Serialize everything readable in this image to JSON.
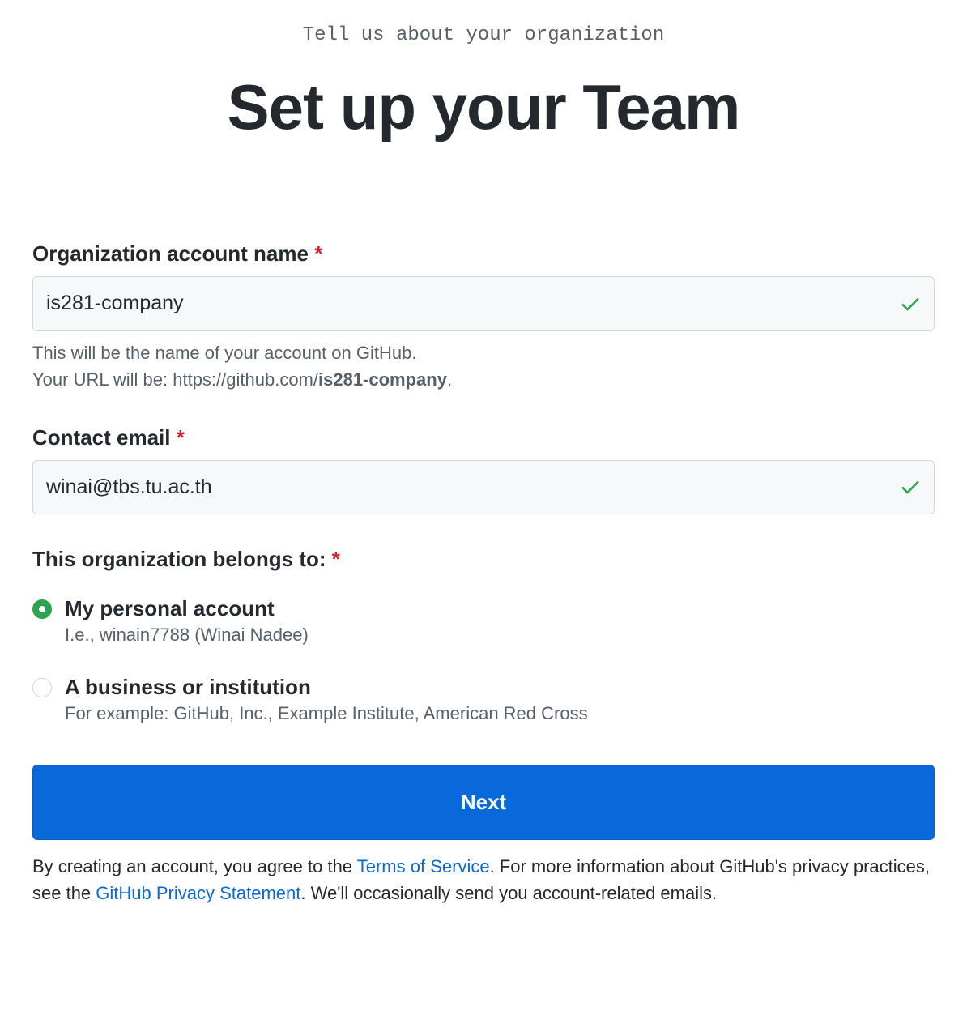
{
  "header": {
    "subtitle": "Tell us about your organization",
    "title": "Set up your Team"
  },
  "form": {
    "org_name": {
      "label": "Organization account name",
      "value": "is281-company",
      "helper_line1": "This will be the name of your account on GitHub.",
      "helper_line2_prefix": "Your URL will be: https://github.com/",
      "helper_line2_bold": "is281-company",
      "helper_line2_suffix": "."
    },
    "email": {
      "label": "Contact email",
      "value": "winai@tbs.tu.ac.th"
    },
    "belongs_to": {
      "label": "This organization belongs to:",
      "options": [
        {
          "title": "My personal account",
          "desc": "I.e., winain7788 (Winai Nadee)",
          "checked": true
        },
        {
          "title": "A business or institution",
          "desc": "For example: GitHub, Inc., Example Institute, American Red Cross",
          "checked": false
        }
      ]
    },
    "next_button": "Next",
    "legal": {
      "part1": "By creating an account, you agree to the ",
      "link1": "Terms of Service",
      "part2": ". For more information about GitHub's privacy practices, see the ",
      "link2": "GitHub Privacy Statement",
      "part3": ". We'll occasionally send you account-related emails."
    }
  }
}
